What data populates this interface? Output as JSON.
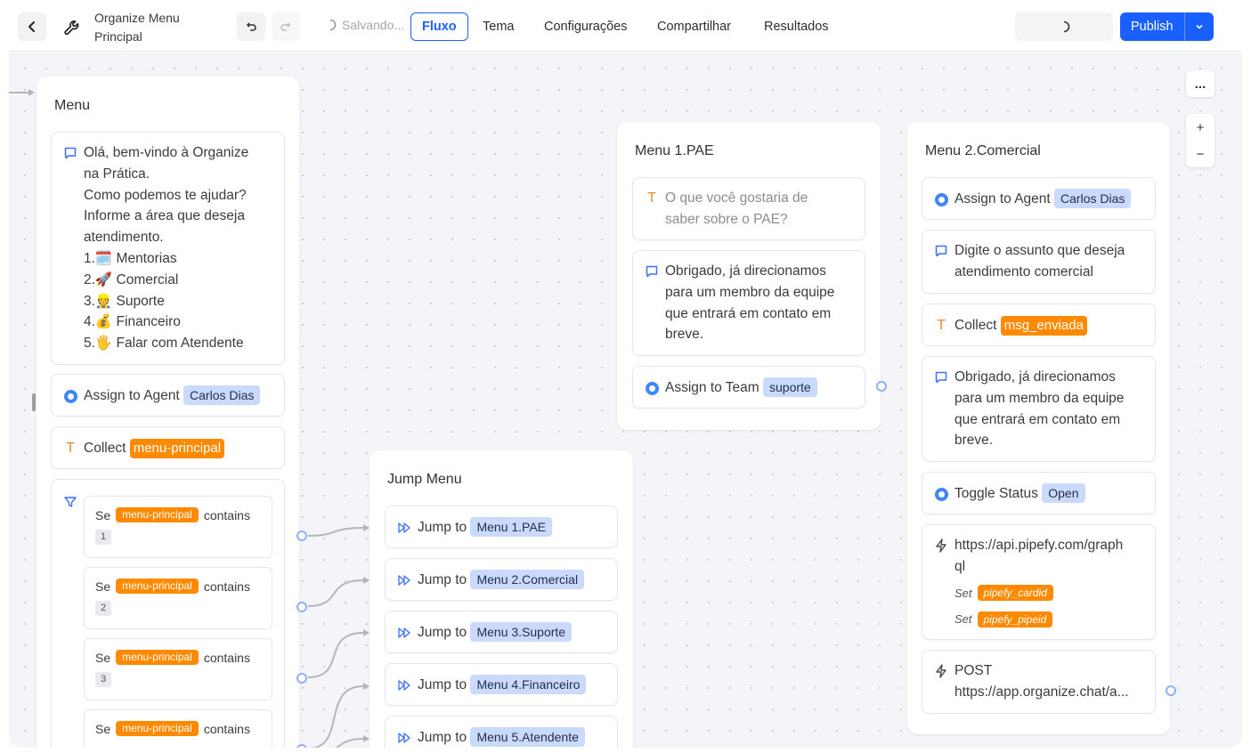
{
  "header": {
    "title": "Organize Menu Principal",
    "saving": "Salvando...",
    "tabs": [
      {
        "label": "Fluxo",
        "active": true
      },
      {
        "label": "Tema"
      },
      {
        "label": "Configurações"
      },
      {
        "label": "Compartilhar"
      },
      {
        "label": "Resultados"
      }
    ],
    "publish": "Publish"
  },
  "toolbar": {
    "more": "...",
    "zoom_in": "+",
    "zoom_out": "−"
  },
  "menu_group": {
    "title": "Menu",
    "welcome_lines": [
      "Olá, bem-vindo à Organize",
      "na Prática.",
      "Como podemos te ajudar?",
      "Informe a área que deseja",
      "atendimento.",
      "1.🗓️ Mentorias",
      "2.🚀 Comercial",
      "3.👷 Suporte",
      "4.💰 Financeiro",
      "5.🖐 Falar com Atendente"
    ],
    "assign_label": "Assign to Agent",
    "assign_value": "Carlos Dias",
    "collect_label": "Collect",
    "collect_var": "menu-principal",
    "conditions": [
      {
        "se": "Se",
        "var": "menu-principal",
        "op": "contains",
        "value": "1"
      },
      {
        "se": "Se",
        "var": "menu-principal",
        "op": "contains",
        "value": "2"
      },
      {
        "se": "Se",
        "var": "menu-principal",
        "op": "contains",
        "value": "3"
      },
      {
        "se": "Se",
        "var": "menu-principal",
        "op": "contains",
        "value": ""
      }
    ]
  },
  "jump_group": {
    "title": "Jump Menu",
    "items": [
      {
        "label": "Jump to",
        "target": "Menu 1.PAE"
      },
      {
        "label": "Jump to",
        "target": "Menu 2.Comercial"
      },
      {
        "label": "Jump to",
        "target": "Menu 3.Suporte"
      },
      {
        "label": "Jump to",
        "target": "Menu 4.Financeiro"
      },
      {
        "label": "Jump to",
        "target": "Menu 5.Atendente"
      }
    ]
  },
  "pae_group": {
    "title": "Menu 1.PAE",
    "question_lines": [
      "O que você gostaria de",
      "saber sobre o PAE?"
    ],
    "thanks_lines": [
      "Obrigado, já direcionamos",
      "para um membro da equipe",
      "que entrará em contato em",
      "breve."
    ],
    "assign_label": "Assign to Team",
    "assign_value": "suporte"
  },
  "comercial_group": {
    "title": "Menu 2.Comercial",
    "assign_label": "Assign to Agent",
    "assign_value": "Carlos Dias",
    "prompt_lines": [
      "Digite o assunto que deseja",
      "atendimento comercial"
    ],
    "collect_label": "Collect",
    "collect_var": "msg_enviada",
    "thanks_lines": [
      "Obrigado, já direcionamos",
      "para um membro da equipe",
      "que entrará em contato em",
      "breve."
    ],
    "toggle_label": "Toggle Status",
    "toggle_value": "Open",
    "webhook_url_lines": [
      "https://api.pipefy.com/graph",
      "ql"
    ],
    "set_label": "Set",
    "set_vars": [
      "pipefy_cardid",
      "pipefy_pipeid"
    ],
    "post_lines": [
      "POST",
      "https://app.organize.chat/a..."
    ]
  },
  "colors": {
    "accent": "#1a5fff",
    "pill_blue": "#c9dafd",
    "pill_orange": "#ff8a00",
    "port": "#8fb0f8"
  }
}
